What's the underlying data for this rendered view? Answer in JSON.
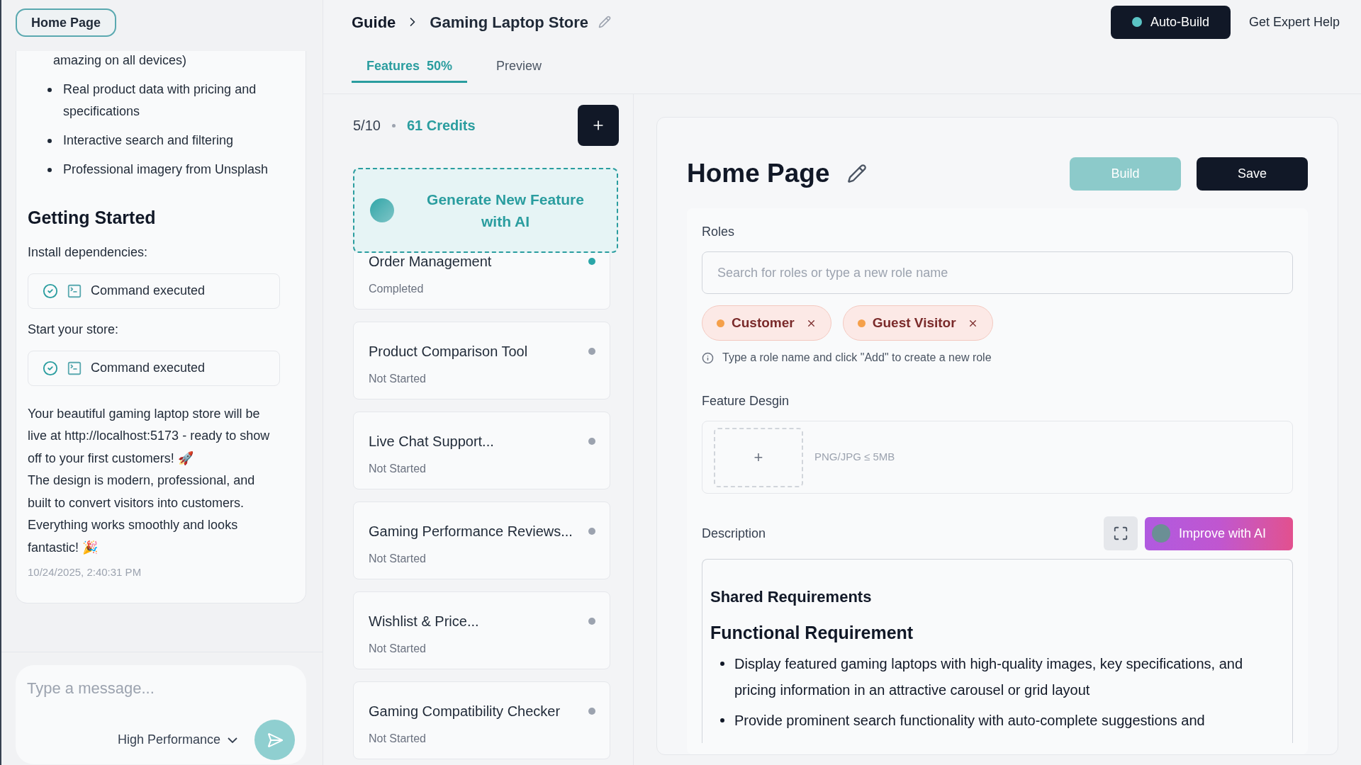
{
  "left_panel": {
    "page_tab": "Home Page",
    "chat": [
      {
        "kind": "continuation",
        "text": "amazing on all devices)"
      },
      {
        "kind": "bullet",
        "text": "Real product data with pricing and specifications"
      },
      {
        "kind": "bullet",
        "text": "Interactive search and filtering"
      },
      {
        "kind": "bullet",
        "text": "Professional imagery from Unsplash"
      },
      {
        "kind": "heading",
        "text": "Getting Started"
      },
      {
        "kind": "para",
        "text": "Install dependencies:"
      },
      {
        "kind": "command",
        "text": "Command executed"
      },
      {
        "kind": "para",
        "text": "Start your store:"
      },
      {
        "kind": "command",
        "text": "Command executed"
      },
      {
        "kind": "body",
        "text": "Your beautiful gaming laptop store will be live at http://localhost:5173 - ready to show off to your first customers! 🚀"
      },
      {
        "kind": "body",
        "text": "The design is modern, professional, and built to convert visitors into customers. Everything works smoothly and looks fantastic! 🎉"
      },
      {
        "kind": "timestamp",
        "text": "10/24/2025, 2:40:31 PM"
      }
    ],
    "message": {
      "placeholder": "Type a message..."
    },
    "model": "High Performance"
  },
  "header": {
    "breadcrumb": [
      "Guide",
      "Gaming Laptop Store"
    ],
    "tabs": [
      {
        "label": "Features",
        "badge": "50%",
        "selected": true
      },
      {
        "label": "Preview",
        "selected": false
      }
    ],
    "auto_build": "Auto-Build",
    "expert_help": "Get Expert Help"
  },
  "features": {
    "count": "5/10",
    "credits": "61 Credits",
    "generate": "Generate New Feature with AI",
    "items": [
      {
        "title": "Order Management",
        "status": "Completed",
        "color": "#2aa6a8"
      },
      {
        "title": "Product Comparison Tool",
        "status": "Not Started",
        "color": "#9ca3af"
      },
      {
        "title": "Live Chat Support...",
        "status": "Not Started",
        "color": "#9ca3af"
      },
      {
        "title": "Gaming Performance Reviews...",
        "status": "Not Started",
        "color": "#9ca3af"
      },
      {
        "title": "Wishlist & Price...",
        "status": "Not Started",
        "color": "#9ca3af"
      },
      {
        "title": "Gaming Compatibility Checker",
        "status": "Not Started",
        "color": "#9ca3af"
      }
    ]
  },
  "editor": {
    "title": "Home Page",
    "build": {
      "label": "Build",
      "disabled": true
    },
    "save": "Save",
    "roles": {
      "label": "Roles",
      "placeholder": "Search for roles or type a new role name",
      "chips": [
        {
          "label": "Customer",
          "color": "#f5a04a"
        },
        {
          "label": "Guest Visitor",
          "color": "#f5a04a"
        }
      ],
      "hint": "Type a role name and click \"Add\" to create a new role"
    },
    "design": {
      "label": "Feature Desgin",
      "plus": "+",
      "hint": "PNG/JPG ≤ 5MB"
    },
    "description": {
      "label": "Description",
      "improve": "Improve with AI",
      "heading": "Shared Requirements",
      "subheading": "Functional Requirement",
      "bullets": [
        "Display featured gaming laptops with high-quality images, key specifications, and pricing information in an attractive carousel or grid layout",
        "Provide prominent search functionality with auto-complete suggestions and"
      ]
    }
  }
}
